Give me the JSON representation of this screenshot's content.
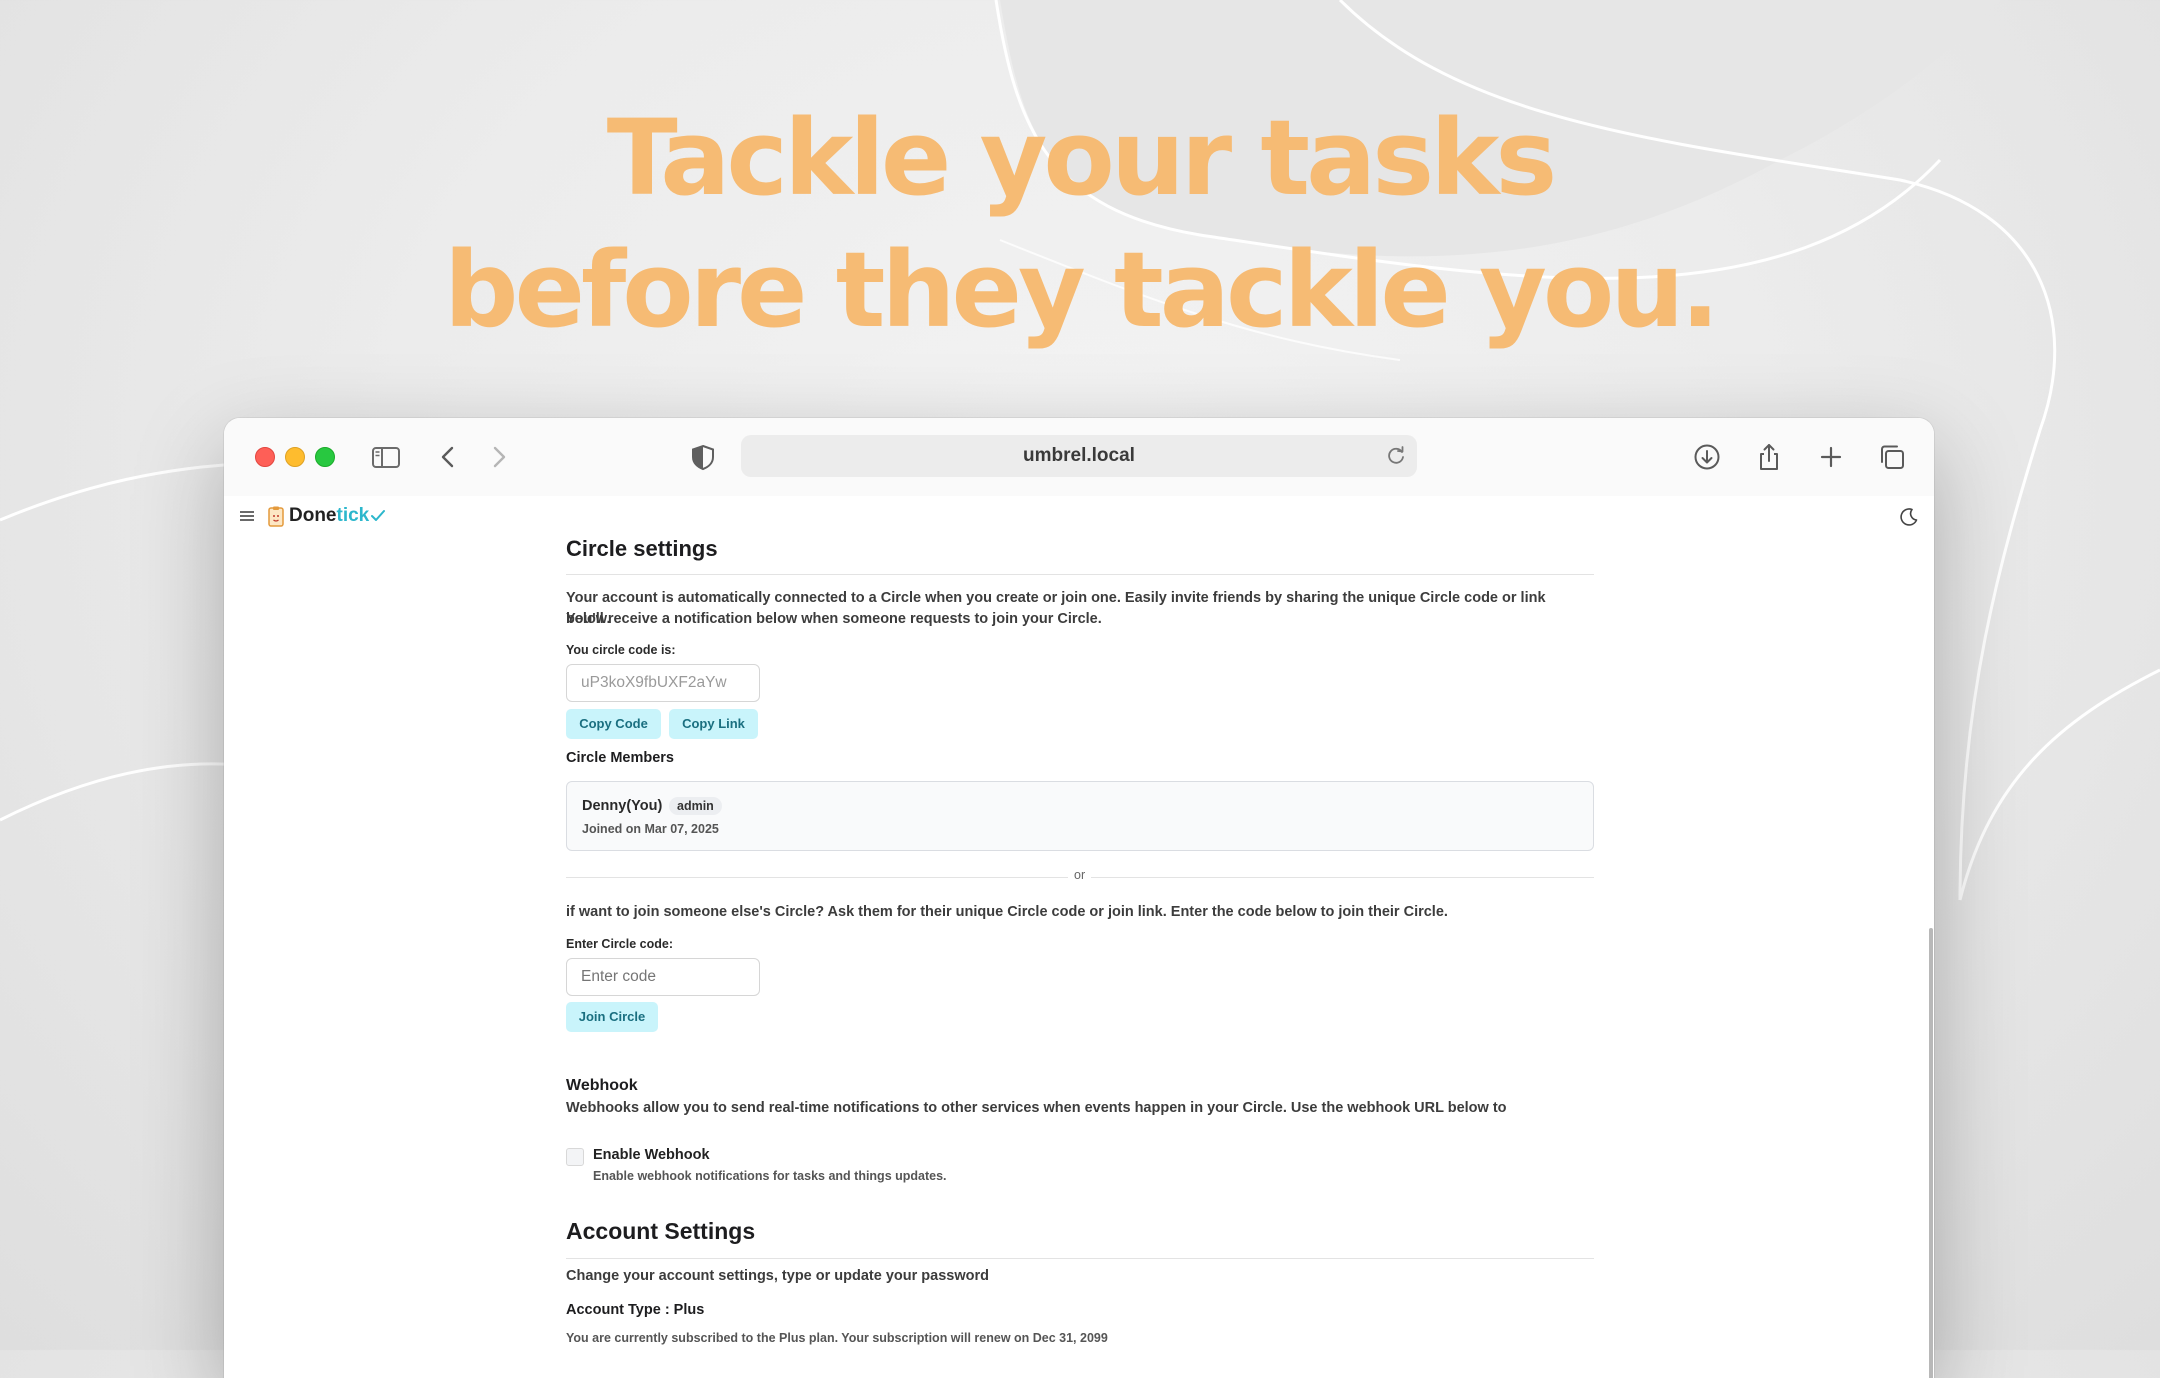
{
  "headline": {
    "line1": "Tackle your tasks",
    "line2": "before they tackle you.",
    "color": "#f6bb74"
  },
  "browser": {
    "url": "umbrel.local",
    "icons": [
      "sidebar-icon",
      "back-icon",
      "forward-icon",
      "privacy-shield-icon",
      "reload-icon",
      "download-icon",
      "share-icon",
      "new-tab-icon",
      "tabs-overview-icon"
    ]
  },
  "app": {
    "logo_done": "Done",
    "logo_tick": "tick",
    "icons": [
      "hamburger-menu-icon",
      "clipboard-logo-icon",
      "checkmark-icon",
      "dark-mode-moon-icon"
    ]
  },
  "circle": {
    "title": "Circle settings",
    "intro_line1": "Your account is automatically connected to a Circle when you create or join one. Easily invite friends by sharing the unique Circle code or link below.",
    "intro_line2": "You'll receive a notification below when someone requests to join your Circle.",
    "code_label": "You circle code is:",
    "code_value": "uP3koX9fbUXF2aYw",
    "copy_code": "Copy Code",
    "copy_link": "Copy Link",
    "members_title": "Circle Members",
    "members": [
      {
        "name": "Denny(You)",
        "role": "admin",
        "joined": "Joined on Mar 07, 2025"
      }
    ],
    "or": "or",
    "join_text": "if want to join someone else's Circle? Ask them for their unique Circle code or join link. Enter the code below to join their Circle.",
    "enter_label": "Enter Circle code:",
    "enter_placeholder": "Enter code",
    "join_button": "Join Circle"
  },
  "webhook": {
    "title": "Webhook",
    "desc": "Webhooks allow you to send real-time notifications to other services when events happen in your Circle. Use the webhook URL below to",
    "enable_label": "Enable Webhook",
    "enable_help": "Enable webhook notifications for tasks and things updates.",
    "enabled": false
  },
  "account": {
    "title": "Account Settings",
    "desc": "Change your account settings, type or update your password",
    "type_label": "Account Type : Plus",
    "subscription_text": "You are currently subscribed to the Plus plan. Your subscription will renew on Dec 31, 2099"
  },
  "accent": "#2cb7cc",
  "button_bg": "#c9f4fb"
}
